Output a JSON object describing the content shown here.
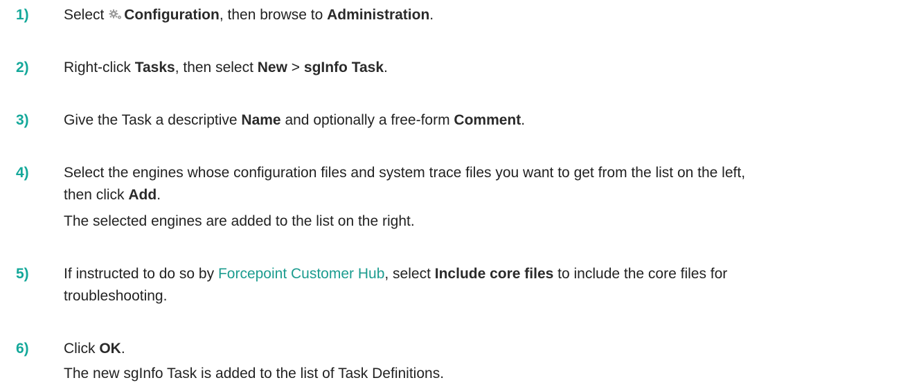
{
  "steps": [
    {
      "number": "1)",
      "parts": {
        "a": "Select ",
        "icon": "gear-icon",
        "b": "Configuration",
        "c": ", then browse to ",
        "d": "Administration",
        "e": "."
      }
    },
    {
      "number": "2)",
      "parts": {
        "a": "Right-click ",
        "b": "Tasks",
        "c": ", then select ",
        "d": "New",
        "e": " > ",
        "f": "sgInfo Task",
        "g": "."
      }
    },
    {
      "number": "3)",
      "parts": {
        "a": "Give the Task a descriptive ",
        "b": "Name",
        "c": " and optionally a free-form ",
        "d": "Comment",
        "e": "."
      }
    },
    {
      "number": "4)",
      "parts": {
        "a": "Select the engines whose configuration files and system trace files you want to get from the list on the left,",
        "b": "then click ",
        "c": "Add",
        "d": ".",
        "result": "The selected engines are added to the list on the right."
      }
    },
    {
      "number": "5)",
      "parts": {
        "a": "If instructed to do so by ",
        "link": "Forcepoint Customer Hub",
        "b": ", select ",
        "c": "Include core files",
        "d": " to include the core files for",
        "e": "troubleshooting."
      }
    },
    {
      "number": "6)",
      "parts": {
        "a": "Click ",
        "b": "OK",
        "c": ".",
        "result": "The new sgInfo Task is added to the list of Task Definitions."
      }
    }
  ],
  "colors": {
    "accent": "#14a89a",
    "link": "#1c9c8f",
    "text": "#222222"
  }
}
